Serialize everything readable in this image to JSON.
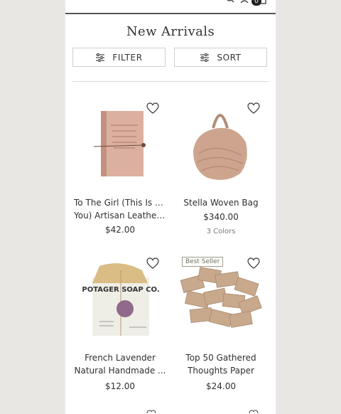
{
  "header": {
    "cart_count": "0"
  },
  "page": {
    "title": "New Arrivals"
  },
  "toolbar": {
    "filter_label": "FILTER",
    "sort_label": "SORT"
  },
  "products": [
    {
      "name_line1": "To The Girl (This Is For",
      "name_line2": "You) Artisan Leather ...",
      "price": "$42.00",
      "colors": ""
    },
    {
      "name_line1": "Stella Woven Bag",
      "name_line2": "",
      "price": "$340.00",
      "colors": "3 Colors"
    },
    {
      "name_line1": "French Lavender",
      "name_line2": "Natural Handmade ...",
      "price": "$12.00",
      "colors": "",
      "product_image_text": "POTAGER SOAP CO."
    },
    {
      "name_line1": "Top 50 Gathered",
      "name_line2": "Thoughts Paper",
      "price": "$24.00",
      "colors": "",
      "badge": "Best Seller"
    }
  ],
  "icons": [
    "menu-icon",
    "search-icon",
    "account-icon",
    "cart-icon",
    "filter-icon",
    "sort-icon",
    "heart-icon"
  ]
}
